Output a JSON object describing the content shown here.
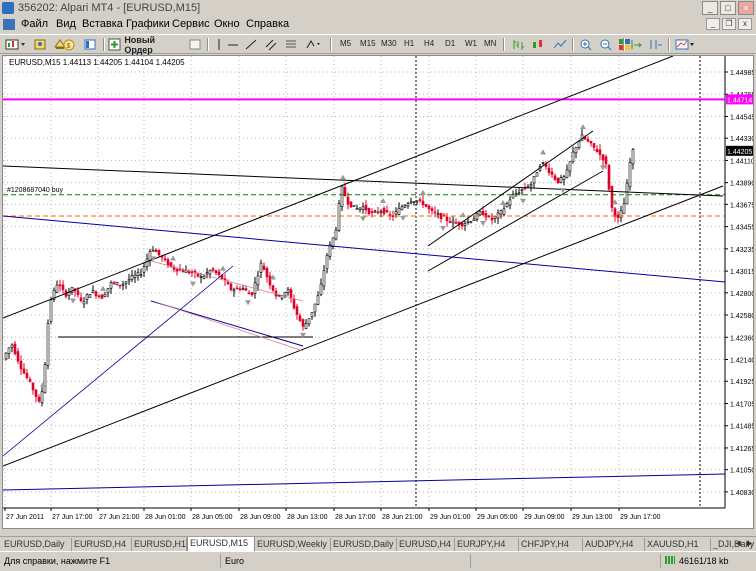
{
  "window": {
    "title": "356202: Alpari MT4 - [EURUSD,M15]",
    "controls": [
      "_",
      "□",
      "×"
    ]
  },
  "menu": {
    "items": [
      "Файл",
      "Вид",
      "Вставка",
      "Графики",
      "Сервис",
      "Окно",
      "Справка"
    ]
  },
  "toolbar": {
    "new_order_label": "Новый Ордер",
    "timeframes": [
      "M5",
      "M15",
      "M30",
      "H1",
      "H4",
      "D1",
      "W1",
      "MN"
    ]
  },
  "chart": {
    "symbol_info": "EURUSD,M15  1.44113 1.44205 1.44104 1.44205",
    "order_label": "#1208687040 buy",
    "price_ticks": [
      "1.44985",
      "1.44765",
      "1.44545",
      "1.44330",
      "1.44110",
      "1.43890",
      "1.43675",
      "1.43455",
      "1.43235",
      "1.43015",
      "1.42800",
      "1.42580",
      "1.42360",
      "1.42140",
      "1.41925",
      "1.41705",
      "1.41485",
      "1.41265",
      "1.41050",
      "1.40830"
    ],
    "time_ticks": [
      "27 Jun 2011",
      "27 Jun 17:00",
      "27 Jun 21:00",
      "28 Jun 01:00",
      "28 Jun 05:00",
      "28 Jun 09:00",
      "28 Jun 13:00",
      "28 Jun 17:00",
      "28 Jun 21:00",
      "29 Jun 01:00",
      "29 Jun 05:00",
      "29 Jun 09:00",
      "29 Jun 13:00",
      "29 Jun 17:00"
    ],
    "magenta_price": "1.44714",
    "current_price": "1.44205",
    "colors": {
      "bull": "#000000",
      "bear": "#e0002a",
      "magenta": "#ff00ff",
      "order_green": "#008000",
      "orange": "#ff6600",
      "navy": "#0000a0"
    }
  },
  "tabs": {
    "items": [
      "EURUSD,Daily",
      "EURUSD,H4",
      "EURUSD,H1",
      "EURUSD,M15",
      "EURUSD,Weekly",
      "EURUSD,Daily",
      "EURUSD,H4",
      "EURJPY,H4",
      "CHFJPY,H4",
      "AUDJPY,H4",
      "XAUUSD,H1",
      "_DJI,Daily"
    ],
    "active_index": 3
  },
  "status": {
    "help": "Для справки, нажмите F1",
    "profile": "Euro",
    "traffic": "46161/18 kb"
  }
}
